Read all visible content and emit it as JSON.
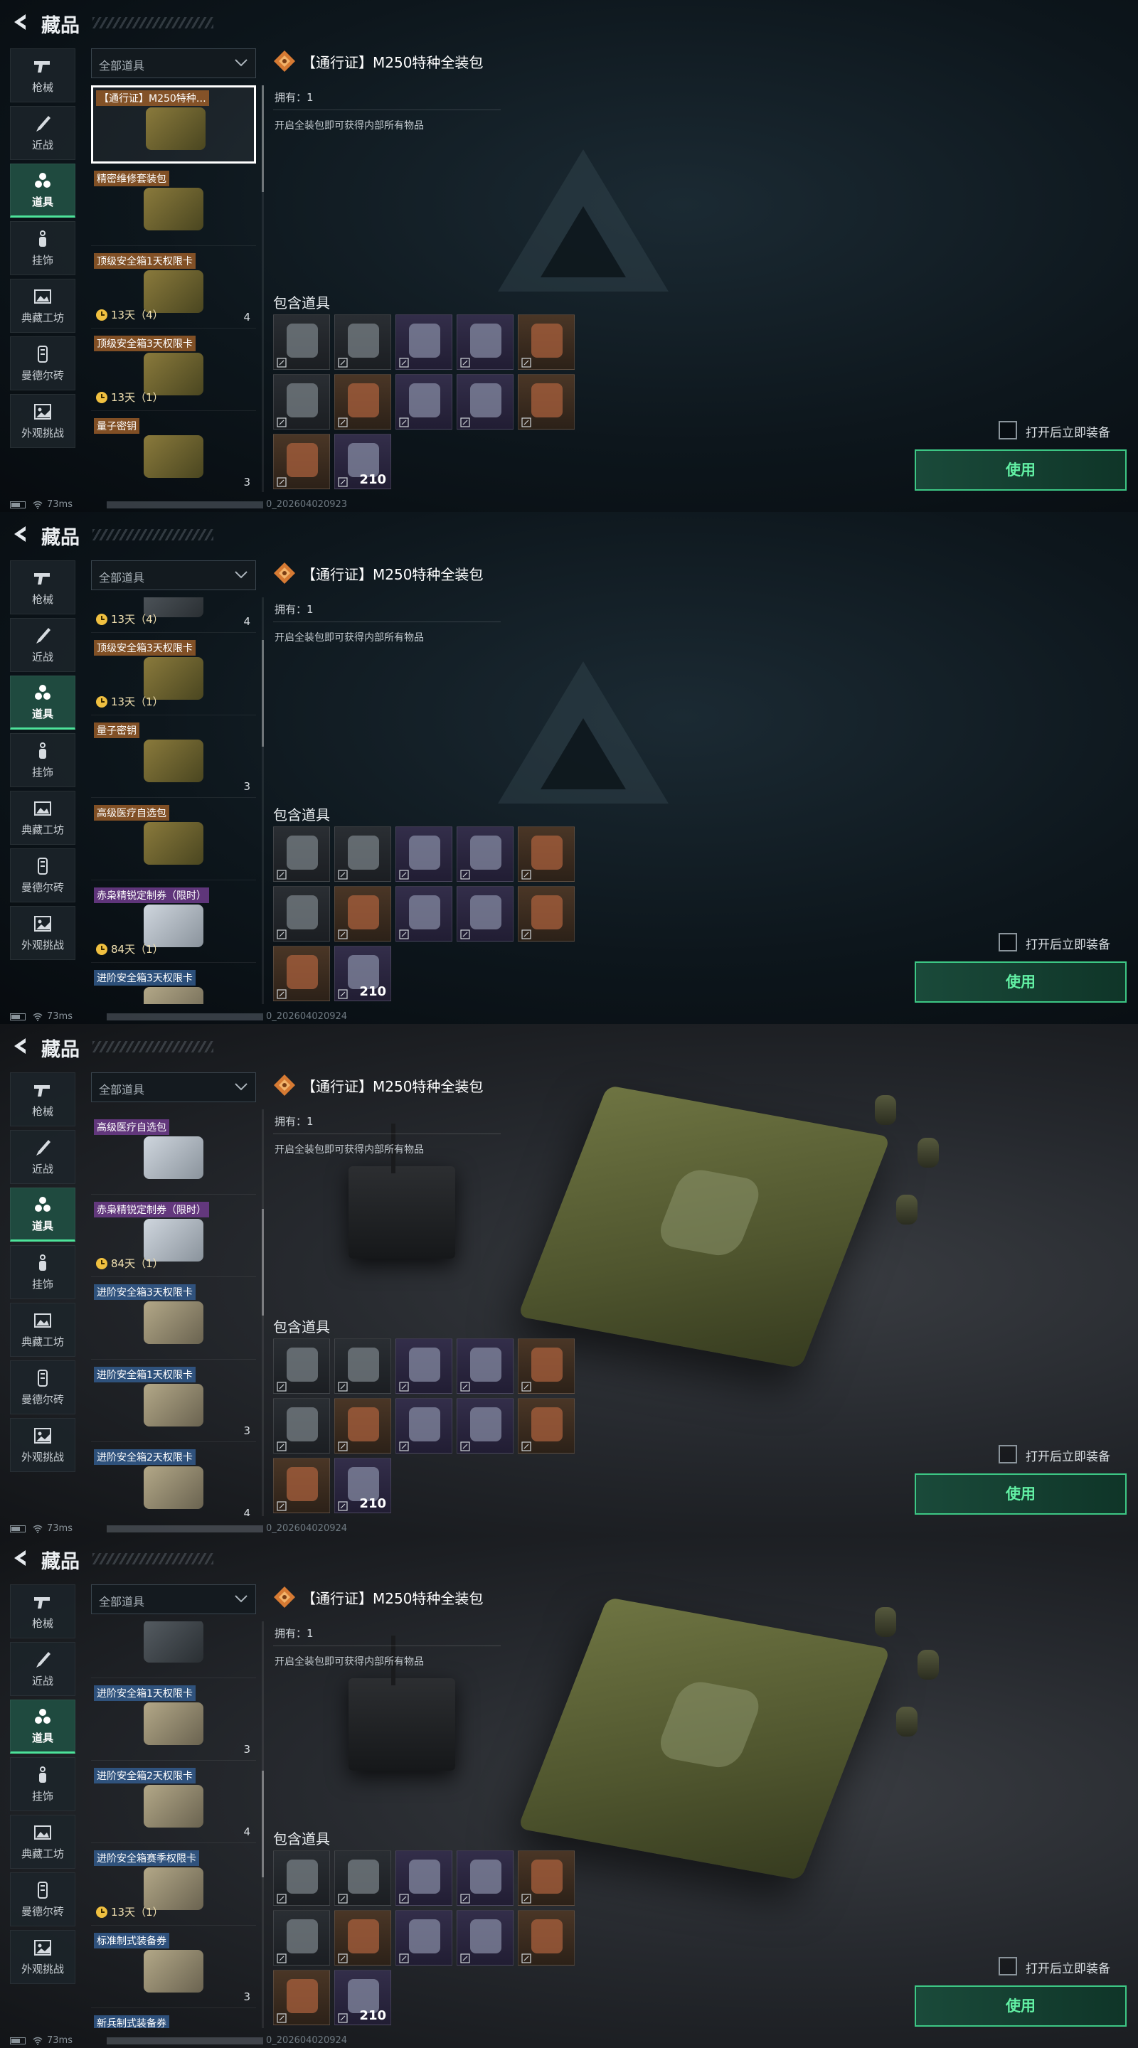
{
  "header": {
    "title": "藏品"
  },
  "categories": [
    {
      "label": "枪械",
      "icon": "gun-icon",
      "active": false
    },
    {
      "label": "近战",
      "icon": "knife-icon",
      "active": false
    },
    {
      "label": "道具",
      "icon": "items-icon",
      "active": true
    },
    {
      "label": "挂饰",
      "icon": "charm-icon",
      "active": false
    },
    {
      "label": "典藏工坊",
      "icon": "gallery-icon",
      "active": false
    },
    {
      "label": "曼德尔砖",
      "icon": "brick-icon",
      "active": false
    },
    {
      "label": "外观挑战",
      "icon": "image-icon",
      "active": false
    }
  ],
  "filter": {
    "label": "全部道具"
  },
  "detail": {
    "title": "【通行证】M250特种全装包",
    "owned": "拥有：1",
    "description": "开启全装包即可获得内部所有物品",
    "contains_label": "包含道具",
    "grid_count": "210"
  },
  "equip_toggle": {
    "label": "打开后立即装备",
    "checked": false
  },
  "use_button": {
    "label": "使用"
  },
  "status": {
    "ping": "73ms"
  },
  "frames": [
    {
      "uid_tail": "0_202604020923",
      "items": [
        {
          "name": "【通行证】M250特种…",
          "tag": "orange",
          "timer": "",
          "count": "",
          "selected": true
        },
        {
          "name": "精密维修套装包",
          "tag": "orange",
          "timer": "",
          "count": "",
          "selected": false
        },
        {
          "name": "顶级安全箱1天权限卡",
          "tag": "orange",
          "timer": "13天（4）",
          "count": "4",
          "selected": false
        },
        {
          "name": "顶级安全箱3天权限卡",
          "tag": "orange",
          "timer": "13天（1）",
          "count": "",
          "selected": false
        },
        {
          "name": "量子密钥",
          "tag": "orange",
          "timer": "",
          "count": "3",
          "selected": false
        }
      ]
    },
    {
      "uid_tail": "0_202604020924",
      "items": [
        {
          "name": "",
          "tag": "",
          "timer": "13天（4）",
          "count": "4",
          "selected": false
        },
        {
          "name": "顶级安全箱3天权限卡",
          "tag": "orange",
          "timer": "13天（1）",
          "count": "",
          "selected": false
        },
        {
          "name": "量子密钥",
          "tag": "orange",
          "timer": "",
          "count": "3",
          "selected": false
        },
        {
          "name": "高级医疗自选包",
          "tag": "orange",
          "timer": "",
          "count": "",
          "selected": false
        },
        {
          "name": "赤枭精锐定制券（限时）",
          "tag": "purple",
          "timer": "84天（1）",
          "count": "",
          "selected": false
        },
        {
          "name": "进阶安全箱3天权限卡",
          "tag": "blue",
          "timer": "",
          "count": "",
          "selected": false
        }
      ]
    },
    {
      "uid_tail": "0_202604020924",
      "items": [
        {
          "name": "高级医疗自选包",
          "tag": "purple",
          "timer": "",
          "count": "",
          "selected": false
        },
        {
          "name": "赤枭精锐定制券（限时）",
          "tag": "purple",
          "timer": "84天（1）",
          "count": "",
          "selected": false
        },
        {
          "name": "进阶安全箱3天权限卡",
          "tag": "blue",
          "timer": "",
          "count": "",
          "selected": false
        },
        {
          "name": "进阶安全箱1天权限卡",
          "tag": "blue",
          "timer": "",
          "count": "3",
          "selected": false
        },
        {
          "name": "进阶安全箱2天权限卡",
          "tag": "blue",
          "timer": "",
          "count": "4",
          "selected": false
        }
      ]
    },
    {
      "uid_tail": "0_202604020924",
      "items": [
        {
          "name": "",
          "tag": "",
          "timer": "",
          "count": "",
          "selected": false
        },
        {
          "name": "进阶安全箱1天权限卡",
          "tag": "blue",
          "timer": "",
          "count": "3",
          "selected": false
        },
        {
          "name": "进阶安全箱2天权限卡",
          "tag": "blue",
          "timer": "",
          "count": "4",
          "selected": false
        },
        {
          "name": "进阶安全箱赛季权限卡",
          "tag": "blue",
          "timer": "13天（1）",
          "count": "",
          "selected": false
        },
        {
          "name": "标准制式装备券",
          "tag": "blue",
          "timer": "",
          "count": "3",
          "selected": false
        },
        {
          "name": "新兵制式装备券",
          "tag": "blue",
          "timer": "",
          "count": "",
          "selected": false
        }
      ]
    }
  ],
  "grid_items": [
    {
      "name": "rifle",
      "rarity": "gray"
    },
    {
      "name": "armor-vest",
      "rarity": "gray"
    },
    {
      "name": "chest-rig",
      "rarity": "purple"
    },
    {
      "name": "helmet",
      "rarity": "purple"
    },
    {
      "name": "backpack",
      "rarity": "orange"
    },
    {
      "name": "headset",
      "rarity": "gray"
    },
    {
      "name": "medkit",
      "rarity": "orange"
    },
    {
      "name": "syringe",
      "rarity": "purple"
    },
    {
      "name": "plate",
      "rarity": "purple"
    },
    {
      "name": "battery",
      "rarity": "orange"
    },
    {
      "name": "ammo-box",
      "rarity": "orange"
    },
    {
      "name": "ammo",
      "rarity": "purple"
    }
  ],
  "colors": {
    "accent": "#3dc885",
    "active_cat": "#1f4a3f",
    "tag_orange": "#965a28",
    "tag_blue": "#325a8c",
    "tag_purple": "#6e3c8c"
  }
}
